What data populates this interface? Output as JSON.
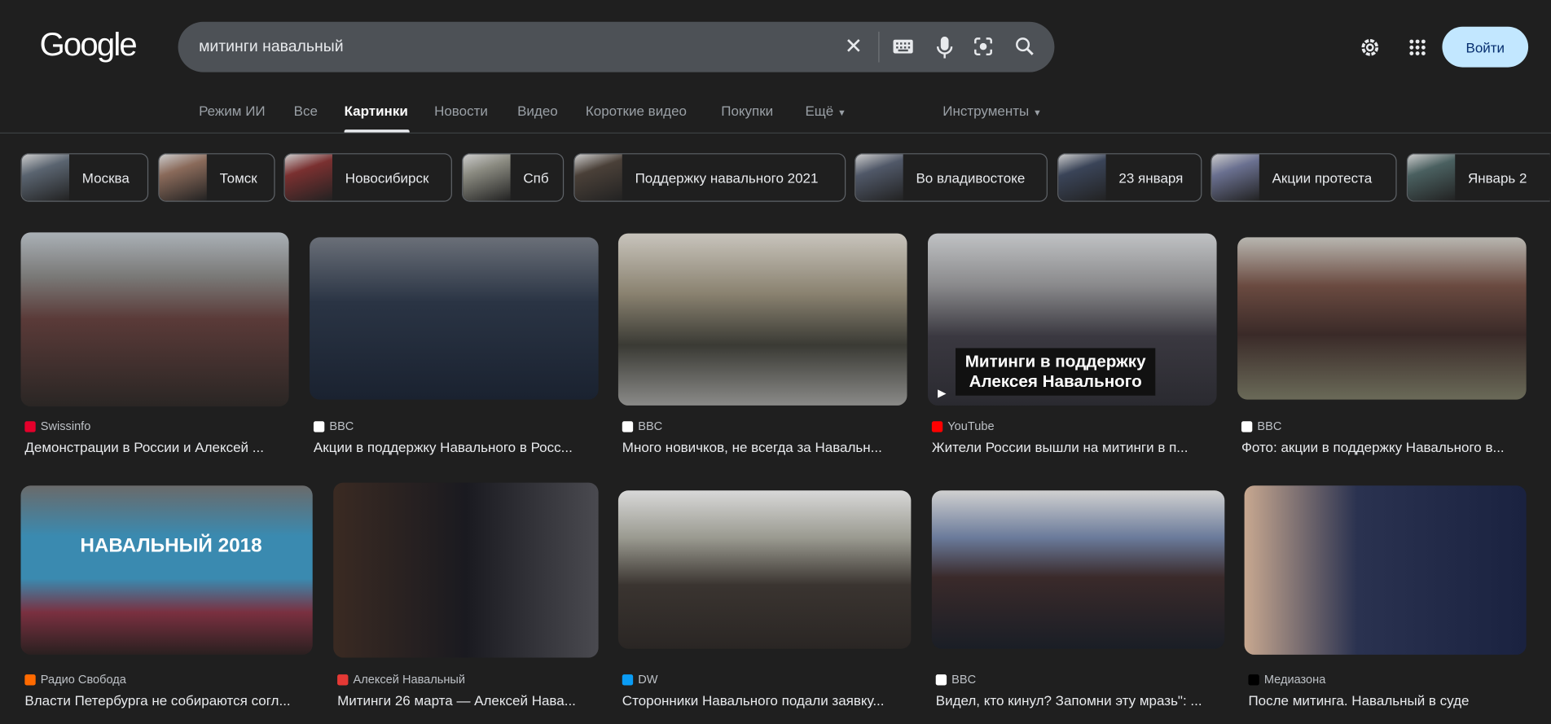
{
  "logo": "Google",
  "search": {
    "value": "митинги навальный",
    "icons": [
      "clear-icon",
      "keyboard-icon",
      "mic-icon",
      "lens-icon",
      "search-icon"
    ]
  },
  "header": {
    "settings_icon": "gear-icon",
    "apps_icon": "apps-grid-icon",
    "login": "Войти"
  },
  "tabs": [
    {
      "label": "Режим ИИ"
    },
    {
      "label": "Все"
    },
    {
      "label": "Картинки",
      "active": true
    },
    {
      "label": "Новости"
    },
    {
      "label": "Видео"
    },
    {
      "label": "Короткие видео"
    },
    {
      "label": "Покупки"
    },
    {
      "label": "Ещё"
    }
  ],
  "tools": "Инструменты",
  "chips": [
    "Москва",
    "Томск",
    "Новосибирск",
    "Спб",
    "Поддержку навального 2021",
    "Во владивостоке",
    "23 января",
    "Акции протеста",
    "Январь 2"
  ],
  "results": [
    {
      "source": "Swissinfo",
      "title": "Демонстрации в России и Алексей ...",
      "color": "#e4002b"
    },
    {
      "source": "BBC",
      "title": "Акции в поддержку Навального в Росс...",
      "color": "#ffffff"
    },
    {
      "source": "BBC",
      "title": "Много новичков, не всегда за Навальн...",
      "color": "#ffffff"
    },
    {
      "source": "YouTube",
      "title": "Жители России вышли на митинги в п...",
      "color": "#ff0000",
      "overlay": "Митинги в поддержку Алексея Навального"
    },
    {
      "source": "BBC",
      "title": "Фото: акции в поддержку Навального в...",
      "color": "#ffffff"
    },
    {
      "source": "Радио Свобода",
      "title": "Власти Петербурга не собираются согл...",
      "color": "#ff6a00",
      "overlay": "НАВАЛЬНЫЙ 2018"
    },
    {
      "source": "Алексей Навальный",
      "title": "Митинги 26 марта — Алексей Нава...",
      "color": "#e53935"
    },
    {
      "source": "DW",
      "title": "Сторонники Навального подали заявку...",
      "color": "#0a9cf5"
    },
    {
      "source": "BBC",
      "title": "Видел, кто кинул? Запомни эту мразь\": ...",
      "color": "#ffffff"
    },
    {
      "source": "Медиазона",
      "title": "После митинга. Навальный в суде",
      "color": "#000000"
    }
  ]
}
